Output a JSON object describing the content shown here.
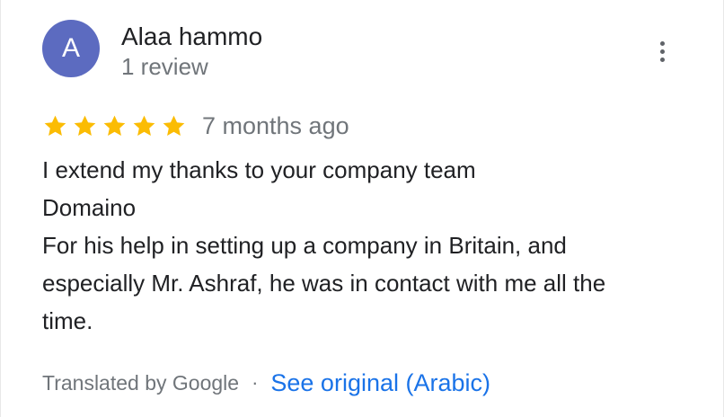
{
  "reviewer": {
    "avatar_initial": "A",
    "avatar_color": "#5c6bc0",
    "name": "Alaa hammo",
    "review_count": "1 review"
  },
  "menu": {
    "icon": "more-vert-icon"
  },
  "rating": {
    "stars": 5,
    "max_stars": 5,
    "star_color": "#fbbc04",
    "time_ago": "7 months ago"
  },
  "review": {
    "lines": [
      "I extend my thanks to your company team",
      "Domaino",
      "For his help in setting up a company in Britain, and",
      "especially Mr. Ashraf, he was in contact with me all the",
      "time."
    ]
  },
  "footer": {
    "translated_by": "Translated by Google",
    "separator": "·",
    "see_original": "See original (Arabic)",
    "link_color": "#1a73e8"
  }
}
